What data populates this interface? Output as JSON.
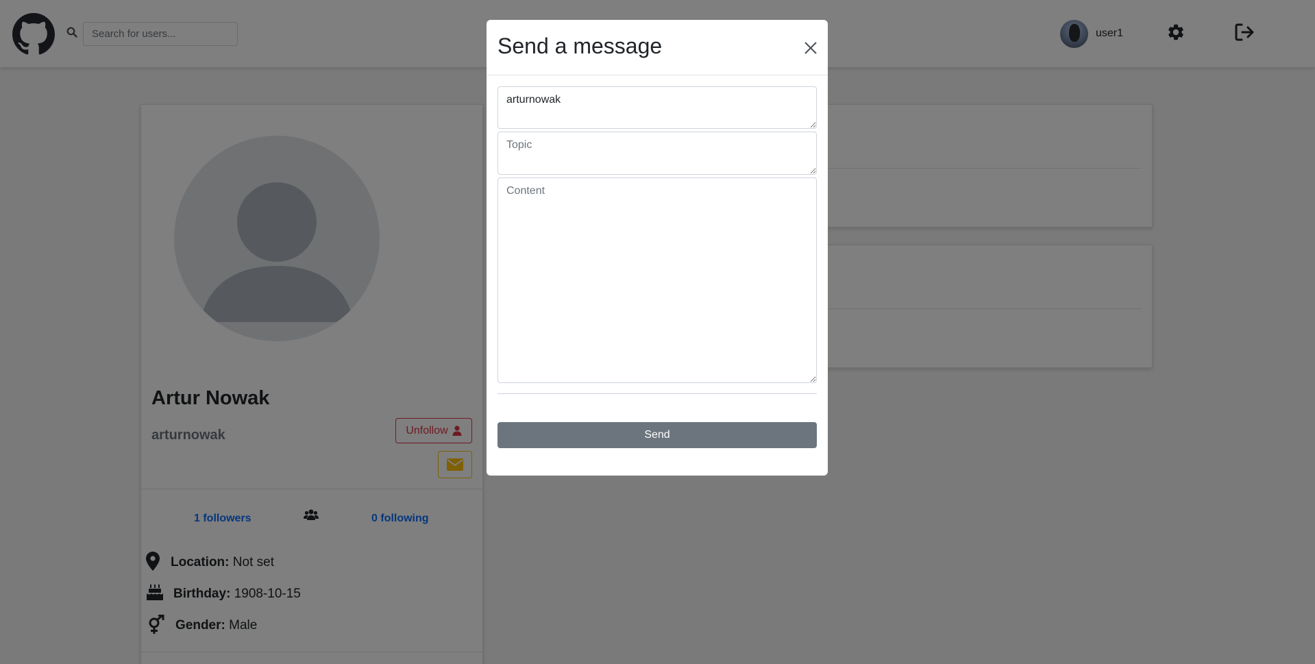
{
  "navbar": {
    "search": {
      "placeholder": "Search for users..."
    },
    "user": {
      "name": "user1"
    }
  },
  "profile": {
    "full_name": "Artur Nowak",
    "username": "arturnowak",
    "unfollow_label": "Unfollow",
    "followers_label": "1 followers",
    "following_label": "0 following",
    "location": {
      "label": "Location:",
      "value": "Not set"
    },
    "birthday": {
      "label": "Birthday:",
      "value": "1908-10-15"
    },
    "gender": {
      "label": "Gender:",
      "value": "Male"
    }
  },
  "modal": {
    "title": "Send a message",
    "recipient_value": "arturnowak",
    "topic_placeholder": "Topic",
    "content_placeholder": "Content",
    "send_label": "Send"
  },
  "colors": {
    "danger": "#dc3545",
    "warning": "#ffc107",
    "link": "#0d6efd",
    "secondary": "#6c757d",
    "backdrop": "rgba(0,0,0,0.5)"
  },
  "icons": [
    "github-logo-icon",
    "search-icon",
    "gear-icon",
    "logout-icon",
    "user-icon",
    "envelope-icon",
    "users-icon",
    "map-marker-icon",
    "birthday-cake-icon",
    "venus-mars-icon",
    "close-icon"
  ]
}
